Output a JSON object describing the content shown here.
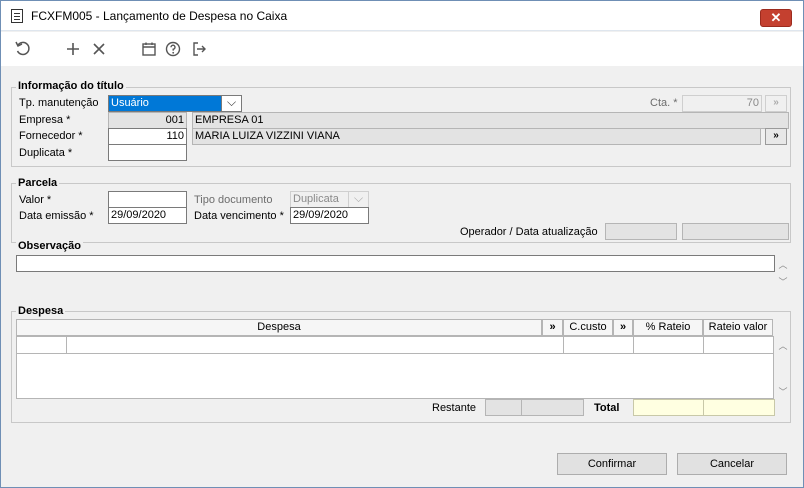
{
  "window": {
    "title": "FCXFM005 - Lançamento de Despesa no Caixa",
    "close_glyph": "✕"
  },
  "toolbar": {
    "icons": [
      "undo-icon",
      "add-icon",
      "close-icon",
      "calendar-icon",
      "help-icon",
      "exit-icon"
    ]
  },
  "info_titulo": {
    "title": "Informação do título",
    "tp_manutencao_label": "Tp. manutenção",
    "tp_manutencao_value": "Usuário",
    "cta_label": "Cta. *",
    "cta_value": "70",
    "cta_button": "»",
    "empresa_label": "Empresa *",
    "empresa_code": "001",
    "empresa_name": "EMPRESA 01",
    "fornecedor_label": "Fornecedor *",
    "fornecedor_code": "110",
    "fornecedor_name": "MARIA LUIZA VIZZINI VIANA",
    "fornecedor_button": "»",
    "duplicata_label": "Duplicata *",
    "duplicata_value": ""
  },
  "parcela": {
    "title": "Parcela",
    "valor_label": "Valor *",
    "valor_value": "",
    "tipo_documento_label": "Tipo documento",
    "tipo_documento_value": "Duplicata",
    "data_emissao_label": "Data emissão *",
    "data_emissao_value": "29/09/2020",
    "data_vencimento_label": "Data vencimento *",
    "data_vencimento_value": "29/09/2020",
    "operador_label": "Operador / Data atualização",
    "operador_value": "",
    "data_atualizacao_value": ""
  },
  "observacao": {
    "title": "Observação",
    "value": ""
  },
  "despesa": {
    "title": "Despesa",
    "columns": [
      "Despesa",
      "»",
      "C.custo",
      "»",
      "% Rateio",
      "Rateio valor"
    ],
    "restante_label": "Restante",
    "restante_value_1": "",
    "restante_value_2": "",
    "total_label": "Total",
    "total_value_1": "",
    "total_value_2": ""
  },
  "footer": {
    "confirm_label": "Confirmar",
    "cancel_label": "Cancelar"
  }
}
